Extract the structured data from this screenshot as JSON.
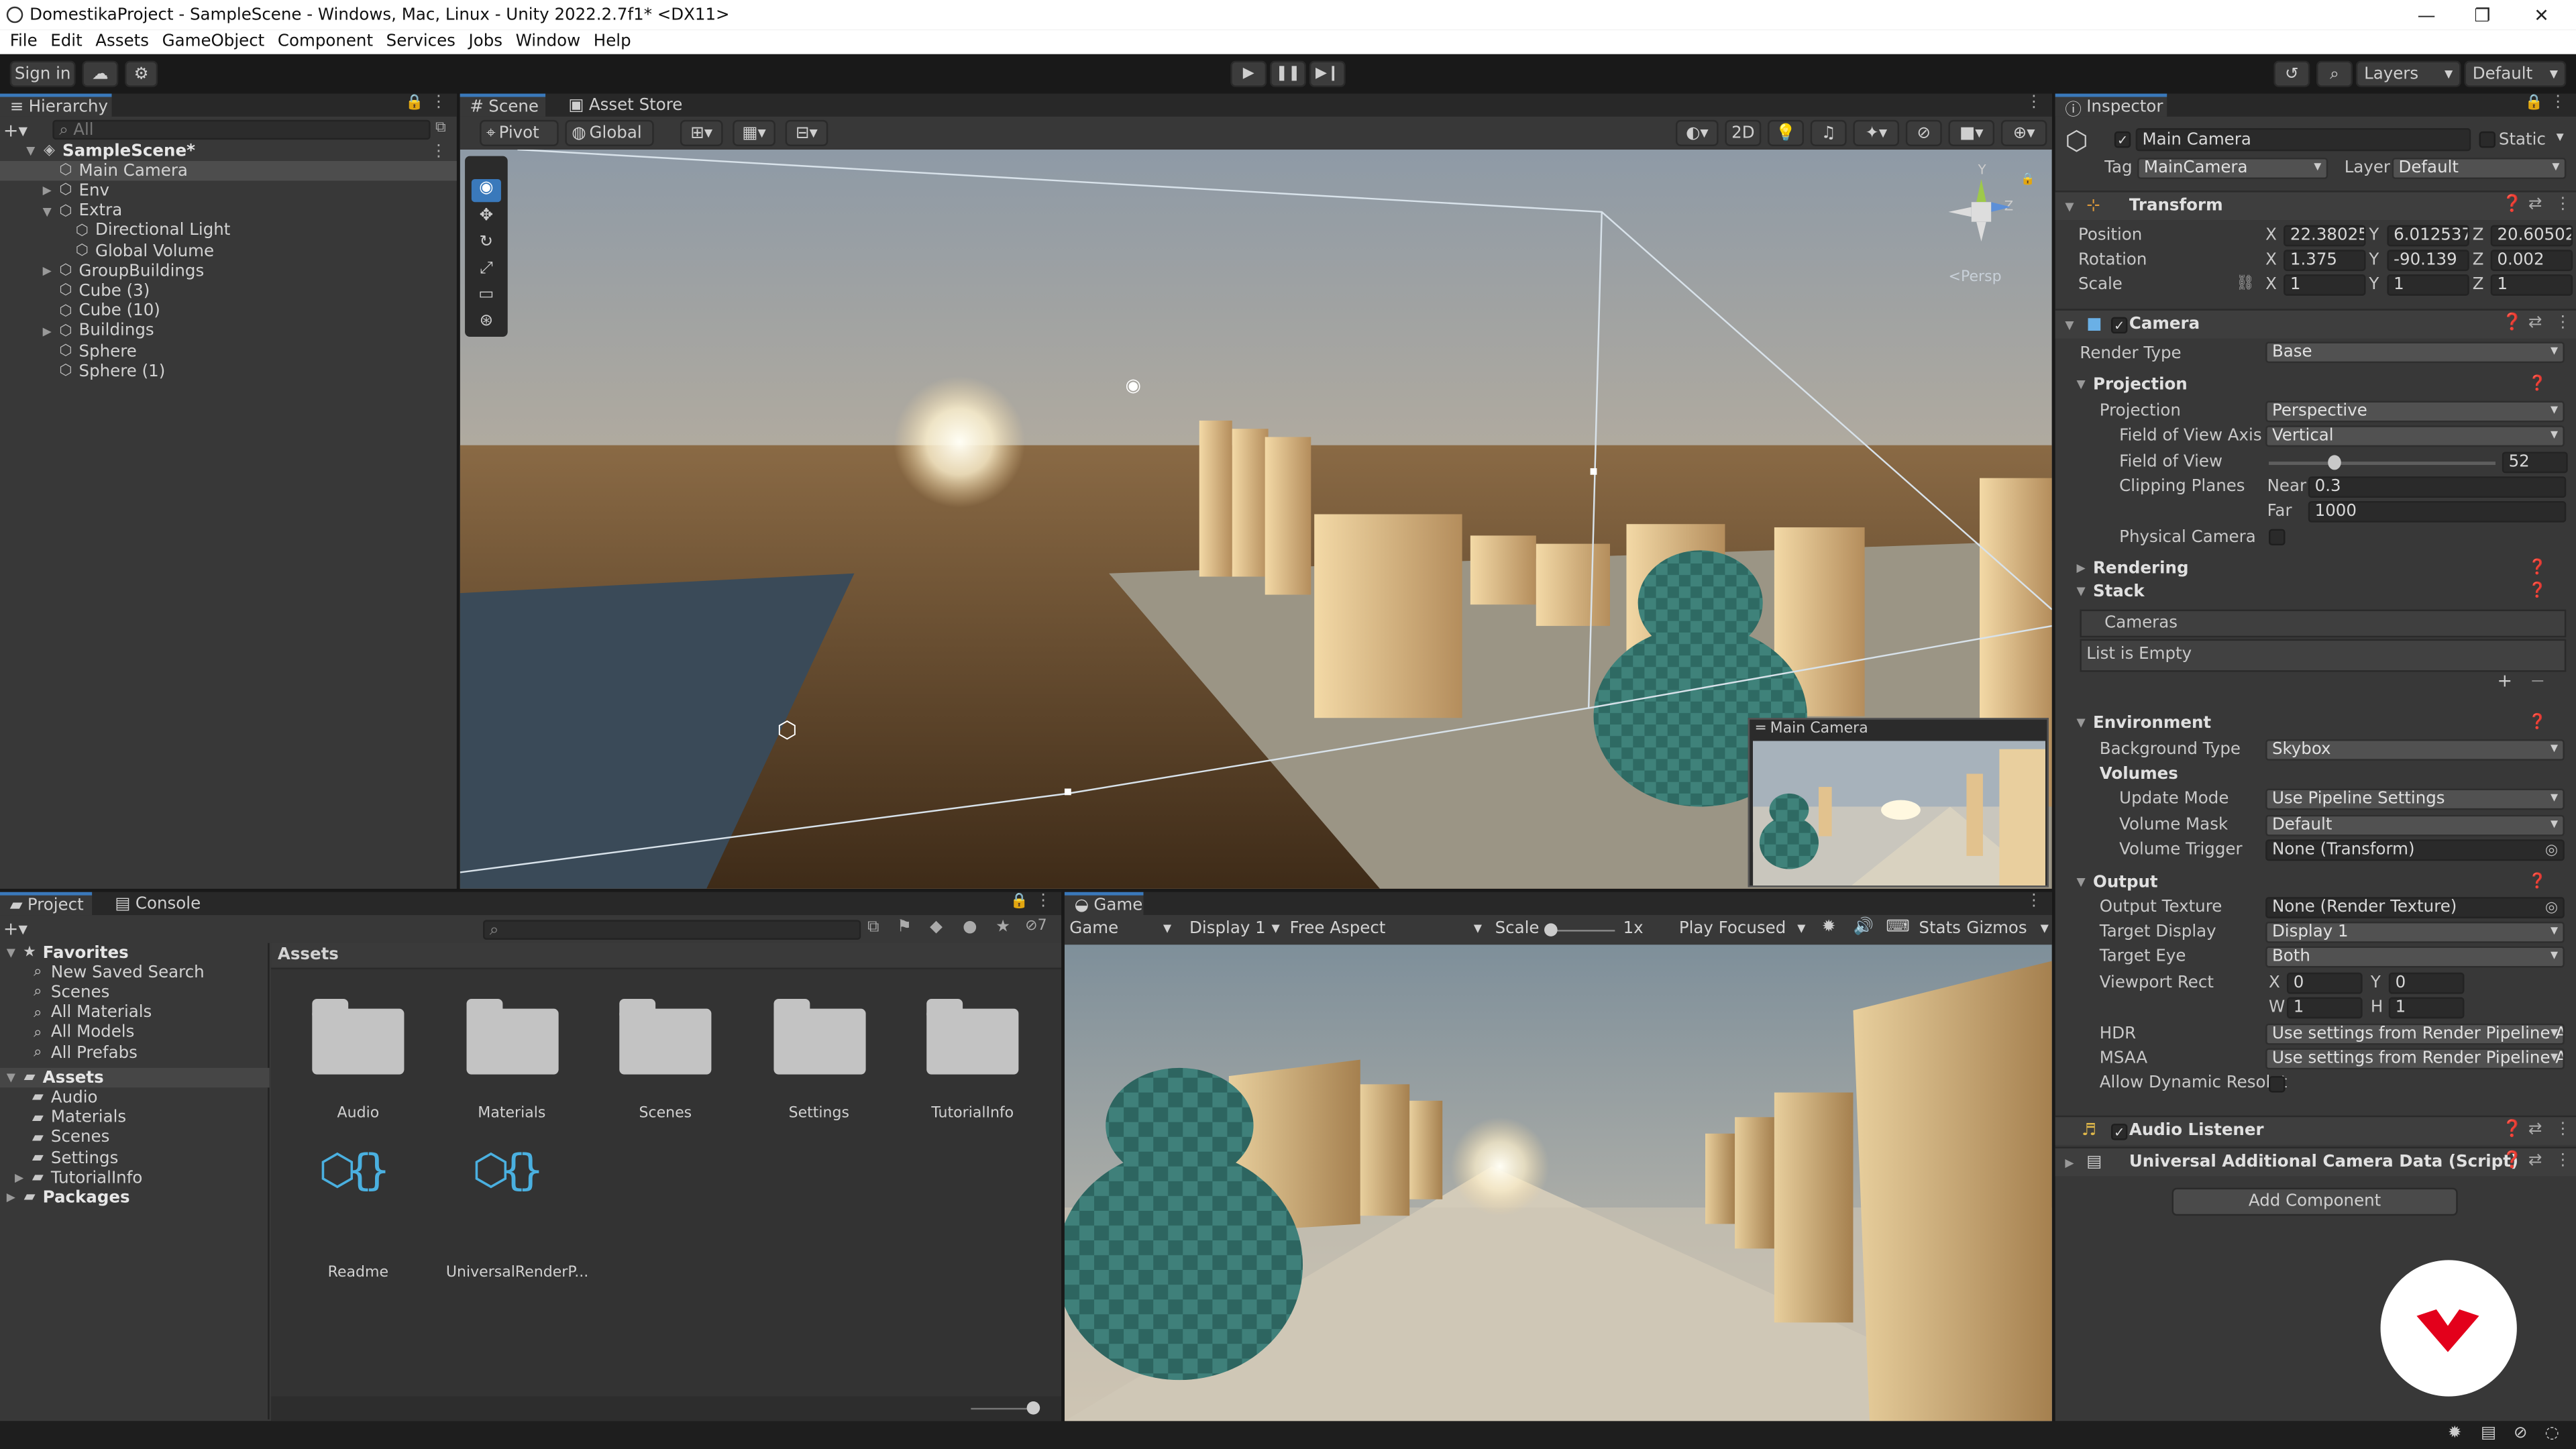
{
  "window": {
    "title": "DomestikaProject - SampleScene - Windows, Mac, Linux - Unity 2022.2.7f1* <DX11>"
  },
  "menu": [
    "File",
    "Edit",
    "Assets",
    "GameObject",
    "Component",
    "Services",
    "Jobs",
    "Window",
    "Help"
  ],
  "toolbar": {
    "sign_in": "Sign in",
    "layers": "Layers",
    "layout": "Default"
  },
  "hierarchy": {
    "tab": "Hierarchy",
    "search_placeholder": "All",
    "items": [
      {
        "label": "SampleScene*",
        "depth": 0,
        "bold": true,
        "expanded": true
      },
      {
        "label": "Main Camera",
        "depth": 1,
        "selected": true
      },
      {
        "label": "Env",
        "depth": 1,
        "collapsed": true
      },
      {
        "label": "Extra",
        "depth": 1,
        "expanded": true
      },
      {
        "label": "Directional Light",
        "depth": 2
      },
      {
        "label": "Global Volume",
        "depth": 2
      },
      {
        "label": "GroupBuildings",
        "depth": 1,
        "collapsed": true
      },
      {
        "label": "Cube (3)",
        "depth": 1
      },
      {
        "label": "Cube (10)",
        "depth": 1
      },
      {
        "label": "Buildings",
        "depth": 1,
        "collapsed": true
      },
      {
        "label": "Sphere",
        "depth": 1
      },
      {
        "label": "Sphere (1)",
        "depth": 1
      }
    ]
  },
  "scene": {
    "tabs": [
      "Scene",
      "Asset Store"
    ],
    "pivot": "Pivot",
    "global": "Global",
    "mode_2d": "2D",
    "persp": "<Persp",
    "preview_title": "Main Camera"
  },
  "project": {
    "tabs": [
      "Project",
      "Console"
    ],
    "tree": [
      {
        "label": "Favorites",
        "depth": 0,
        "bold": true
      },
      {
        "label": "New Saved Search",
        "depth": 1
      },
      {
        "label": "Scenes",
        "depth": 1
      },
      {
        "label": "All Materials",
        "depth": 1
      },
      {
        "label": "All Models",
        "depth": 1
      },
      {
        "label": "All Prefabs",
        "depth": 1
      },
      {
        "label": "Assets",
        "depth": 0,
        "bold": true
      },
      {
        "label": "Audio",
        "depth": 1
      },
      {
        "label": "Materials",
        "depth": 1
      },
      {
        "label": "Scenes",
        "depth": 1
      },
      {
        "label": "Settings",
        "depth": 1
      },
      {
        "label": "TutorialInfo",
        "depth": 1
      },
      {
        "label": "Packages",
        "depth": 0,
        "bold": true
      }
    ],
    "breadcrumb": "Assets",
    "hidden_count": "7",
    "assets": [
      {
        "label": "Audio",
        "type": "folder"
      },
      {
        "label": "Materials",
        "type": "folder"
      },
      {
        "label": "Scenes",
        "type": "folder"
      },
      {
        "label": "Settings",
        "type": "folder"
      },
      {
        "label": "TutorialInfo",
        "type": "folder"
      },
      {
        "label": "Readme",
        "type": "script"
      },
      {
        "label": "UniversalRenderP...",
        "type": "script"
      }
    ]
  },
  "game": {
    "tab": "Game",
    "mode": "Game",
    "display": "Display 1",
    "aspect": "Free Aspect",
    "scale_label": "Scale",
    "scale_value": "1x",
    "play_mode": "Play Focused",
    "stats": "Stats",
    "gizmos": "Gizmos"
  },
  "inspector": {
    "tab": "Inspector",
    "object_name": "Main Camera",
    "static": "Static",
    "tag_label": "Tag",
    "tag": "MainCamera",
    "layer_label": "Layer",
    "layer": "Default",
    "transform": {
      "title": "Transform",
      "position_label": "Position",
      "position": {
        "x": "22.38025",
        "y": "6.012537",
        "z": "20.60502"
      },
      "rotation_label": "Rotation",
      "rotation": {
        "x": "1.375",
        "y": "-90.139",
        "z": "0.002"
      },
      "scale_label": "Scale",
      "scale": {
        "x": "1",
        "y": "1",
        "z": "1"
      }
    },
    "camera": {
      "title": "Camera",
      "render_type_label": "Render Type",
      "render_type": "Base",
      "projection_section": "Projection",
      "projection_label": "Projection",
      "projection": "Perspective",
      "fov_axis_label": "Field of View Axis",
      "fov_axis": "Vertical",
      "fov_label": "Field of View",
      "fov": "52",
      "fov_fraction": 0.29,
      "clipping_label": "Clipping Planes",
      "near_label": "Near",
      "near": "0.3",
      "far_label": "Far",
      "far": "1000",
      "physical_label": "Physical Camera",
      "rendering_section": "Rendering",
      "stack_section": "Stack",
      "cameras_label": "Cameras",
      "list_empty": "List is Empty",
      "environment_section": "Environment",
      "bg_type_label": "Background Type",
      "bg_type": "Skybox",
      "volumes_label": "Volumes",
      "update_mode_label": "Update Mode",
      "update_mode": "Use Pipeline Settings",
      "volume_mask_label": "Volume Mask",
      "volume_mask": "Default",
      "volume_trigger_label": "Volume Trigger",
      "volume_trigger": "None (Transform)",
      "output_section": "Output",
      "output_texture_label": "Output Texture",
      "output_texture": "None (Render Texture)",
      "target_display_label": "Target Display",
      "target_display": "Display 1",
      "target_eye_label": "Target Eye",
      "target_eye": "Both",
      "viewport_label": "Viewport Rect",
      "viewport": {
        "x": "0",
        "y": "0",
        "w": "1",
        "h": "1"
      },
      "hdr_label": "HDR",
      "hdr": "Use settings from Render Pipeline Ass",
      "msaa_label": "MSAA",
      "msaa": "Use settings from Render Pipeline Ass",
      "allow_dyn_label": "Allow Dynamic Resolut"
    },
    "audio_listener": "Audio Listener",
    "urp_data": "Universal Additional Camera Data (Script)",
    "add_component": "Add Component"
  },
  "axis_letters": {
    "x": "X",
    "y": "Y",
    "z": "Z",
    "w": "W",
    "h": "H"
  },
  "colors": {
    "accent": "#3a79bb",
    "watermark": "#e3001b"
  }
}
